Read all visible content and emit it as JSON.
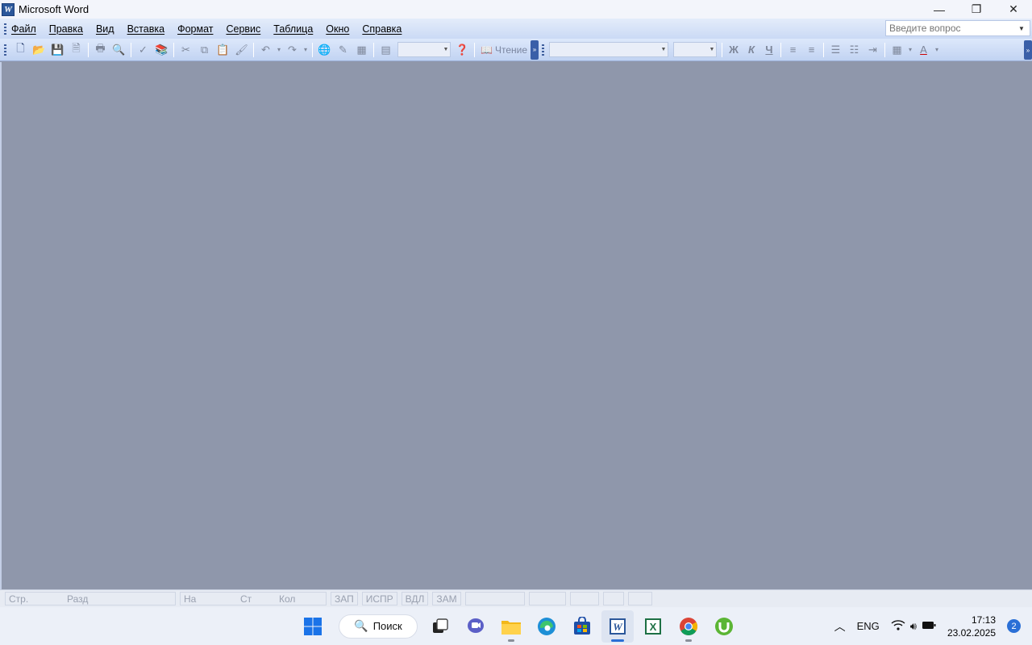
{
  "window": {
    "title": "Microsoft Word",
    "icon": "word-doc-icon"
  },
  "window_controls": {
    "minimize": "—",
    "restore": "❐",
    "close": "✕"
  },
  "menu": [
    {
      "label": "Файл"
    },
    {
      "label": "Правка"
    },
    {
      "label": "Вид"
    },
    {
      "label": "Вставка"
    },
    {
      "label": "Формат"
    },
    {
      "label": "Сервис"
    },
    {
      "label": "Таблица"
    },
    {
      "label": "Окно"
    },
    {
      "label": "Справка"
    }
  ],
  "help_search": {
    "placeholder": "Введите вопрос"
  },
  "toolbar": {
    "reading_label": "Чтение"
  },
  "statusbar": {
    "page": "Стр.",
    "section": "Разд",
    "at": "На",
    "line": "Ст",
    "column": "Кол",
    "rec": "ЗАП",
    "trk": "ИСПР",
    "ext": "ВДЛ",
    "ovr": "ЗАМ"
  },
  "taskbar": {
    "search_label": "Поиск",
    "lang": "ENG",
    "time": "17:13",
    "date": "23.02.2025",
    "notifications": "2"
  }
}
